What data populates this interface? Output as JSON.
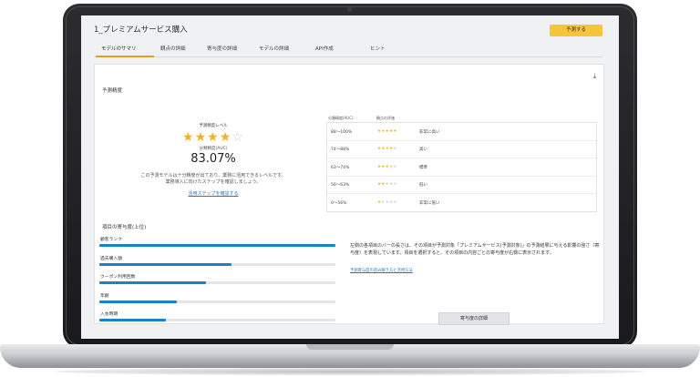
{
  "page": {
    "title": "1_プレミアムサービス購入",
    "predict_button": "予測する"
  },
  "tabs": [
    "モデルのサマリ",
    "観点の詳細",
    "寄与度の詳細",
    "モデルの詳細",
    "API作成",
    "ヒント"
  ],
  "accuracy": {
    "section_title": "予測精度",
    "level_label": "予測精度レベル",
    "stars_filled": 4,
    "stars_total": 5,
    "auc_label": "分類精度(AUC)",
    "auc_value": "83.07%",
    "message_line1": "この予測モデルは十分精度が出ており、業務に活用できるレベルです。",
    "message_line2": "業務導入に向けたステップを確認しましょう。",
    "link": "活用ステップを確認する"
  },
  "auc_table": {
    "headers": [
      "分類精度(AUC)",
      "観点の評価"
    ],
    "rows": [
      {
        "range": "88〜100%",
        "stars": 5,
        "label": "非常に高い"
      },
      {
        "range": "74〜88%",
        "stars": 4,
        "label": "高い"
      },
      {
        "range": "63〜74%",
        "stars": 3,
        "label": "標準"
      },
      {
        "range": "56〜63%",
        "stars": 2,
        "label": "低い"
      },
      {
        "range": "0〜56%",
        "stars": 1,
        "label": "非常に低い"
      }
    ]
  },
  "contribution": {
    "section_title": "項目の寄与度(上位)",
    "items": [
      {
        "label": "顧客ランク",
        "value": 1.0
      },
      {
        "label": "過去購入額",
        "value": 0.56
      },
      {
        "label": "クーポン利用回数",
        "value": 0.45
      },
      {
        "label": "年齢",
        "value": 0.33
      },
      {
        "label": "入会時期",
        "value": 0.28
      }
    ],
    "description": "左側の各項目のバーの長さは、その項目が予測対象「プレミアムサービス(予測対象)」の予測結果に与える影響の強さ（寄与度）を表現しています。項目を選択すると、その項目の内容ごとの寄与度が右側に表示されます。",
    "link": "予測寄与度の読み解き方と活用方法",
    "detail_button": "寄与度の詳細"
  },
  "colors": {
    "accent": "#f7c53c",
    "bar": "#1a83c6",
    "star": "#f0b323",
    "link": "#2a78c2"
  }
}
